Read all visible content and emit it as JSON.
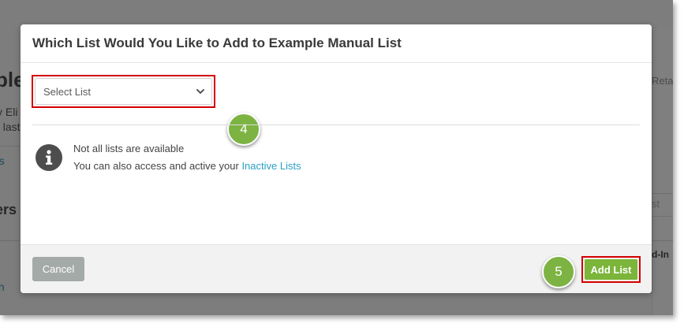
{
  "background": {
    "title_fragment": "ple",
    "sub_line1": "y Eli",
    "sub_line2": "t last",
    "link1": "rs",
    "section": "ers",
    "link2": "th",
    "right_ret": "Reta",
    "right_placeholder": "st",
    "right_addin": "d-In"
  },
  "modal": {
    "title": "Which List Would You Like to Add to Example Manual List",
    "select": {
      "value": "Select List"
    },
    "info": {
      "line1": "Not all lists are available",
      "line2_prefix": "You can also access and active your ",
      "line2_link": "Inactive Lists"
    },
    "footer": {
      "cancel_label": "Cancel",
      "add_label": "Add List"
    }
  },
  "steps": {
    "select_step": "4",
    "add_step": "5"
  },
  "colors": {
    "accent_green": "#7bb53a",
    "highlight_red": "#d40000",
    "link_blue": "#2b9fc4",
    "cancel_gray": "#a4aaa8"
  },
  "icons": [
    "chevron-down-icon",
    "info-icon"
  ]
}
